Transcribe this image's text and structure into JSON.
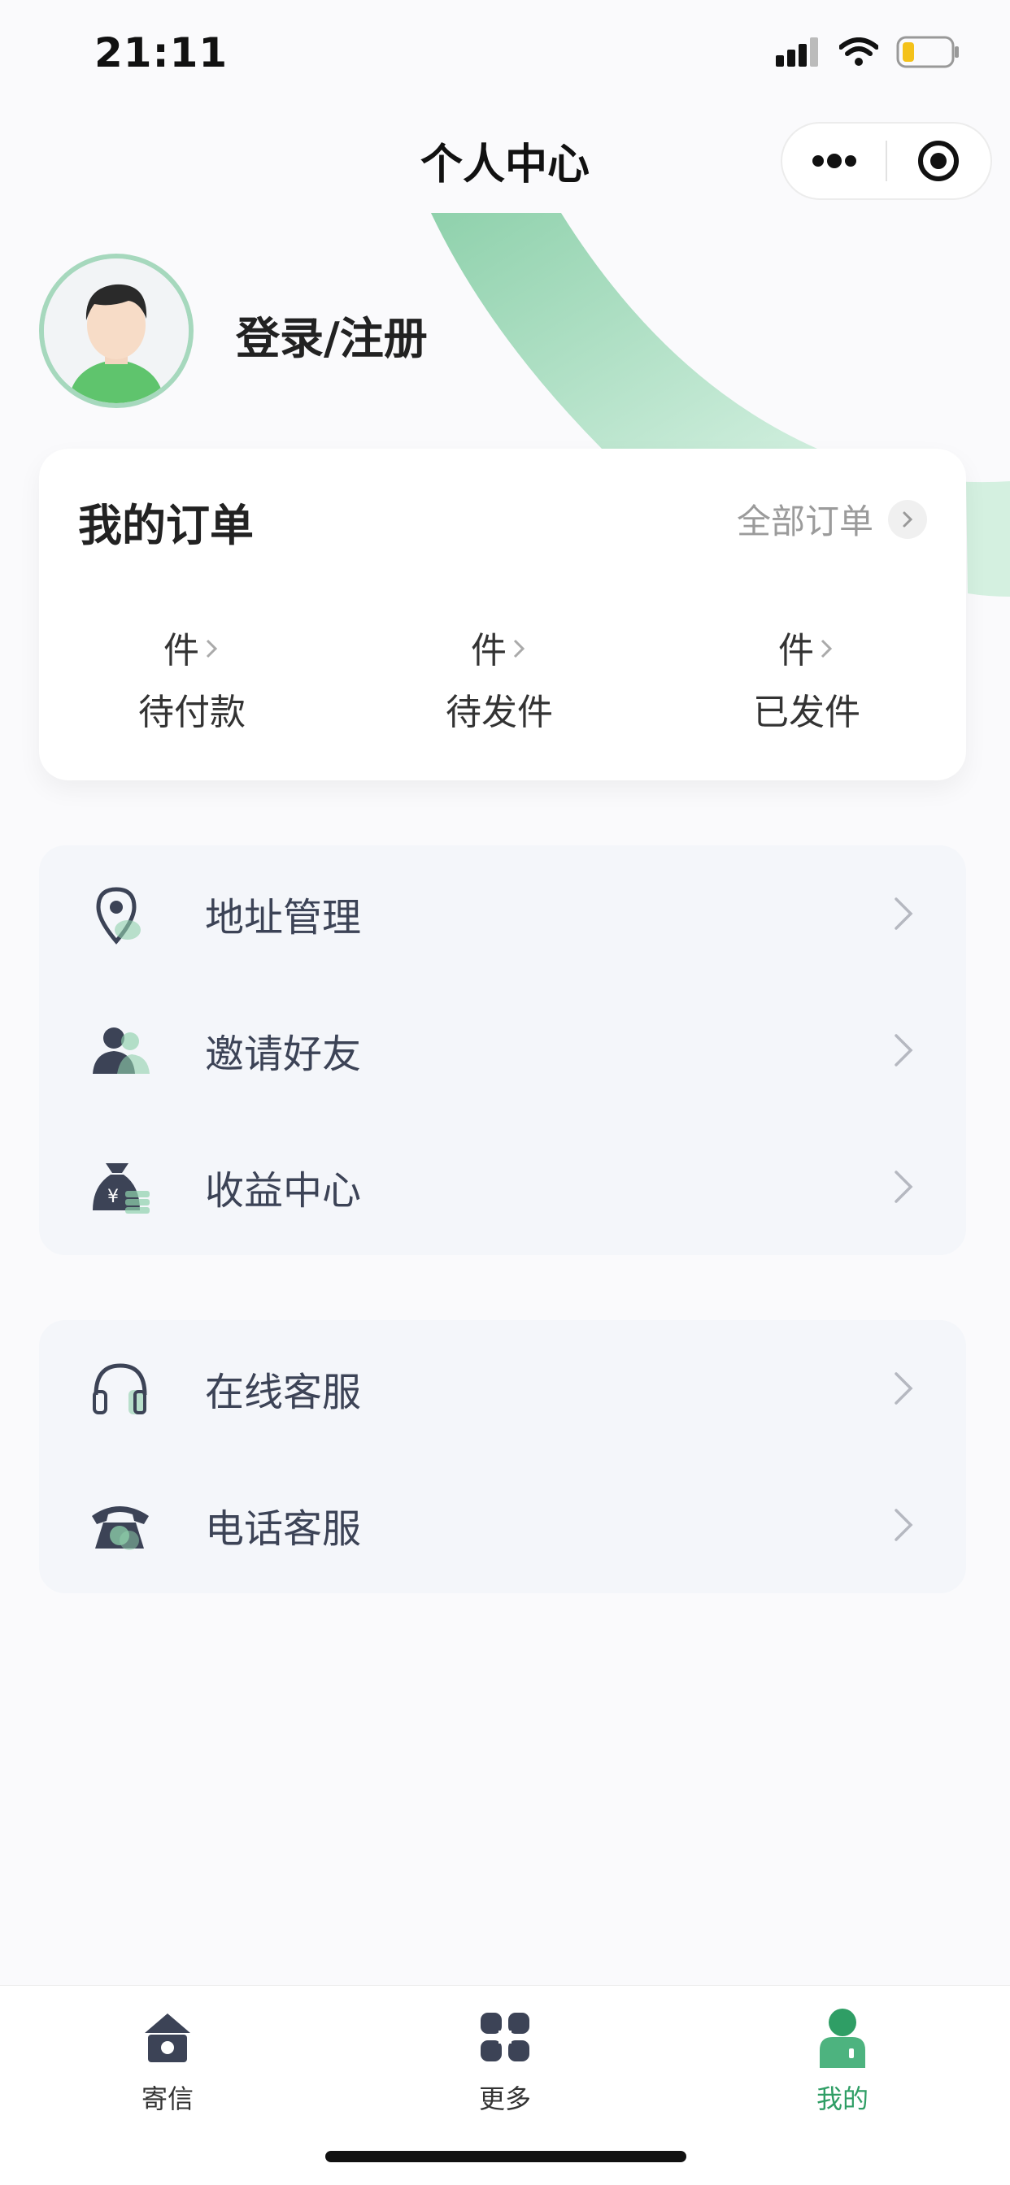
{
  "status_bar": {
    "time": "21:11"
  },
  "nav": {
    "title": "个人中心"
  },
  "user": {
    "login_label": "登录/注册"
  },
  "orders": {
    "title": "我的订单",
    "view_all_label": "全部订单",
    "stats": [
      {
        "count_unit": "件",
        "label": "待付款"
      },
      {
        "count_unit": "件",
        "label": "待发件"
      },
      {
        "count_unit": "件",
        "label": "已发件"
      }
    ]
  },
  "menu_group_1": [
    {
      "label": "地址管理",
      "icon": "location-pin-icon"
    },
    {
      "label": "邀请好友",
      "icon": "users-icon"
    },
    {
      "label": "收益中心",
      "icon": "money-bag-icon"
    }
  ],
  "menu_group_2": [
    {
      "label": "在线客服",
      "icon": "headset-icon"
    },
    {
      "label": "电话客服",
      "icon": "telephone-icon"
    }
  ],
  "tab_bar": [
    {
      "label": "寄信",
      "icon": "home-icon",
      "active": false
    },
    {
      "label": "更多",
      "icon": "grid-icon",
      "active": false
    },
    {
      "label": "我的",
      "icon": "profile-icon",
      "active": true
    }
  ],
  "colors": {
    "accent": "#2f9e65",
    "arc": "#9fd9b9",
    "menu_bg": "#f4f6fa",
    "text_secondary": "#9b9b9b"
  }
}
